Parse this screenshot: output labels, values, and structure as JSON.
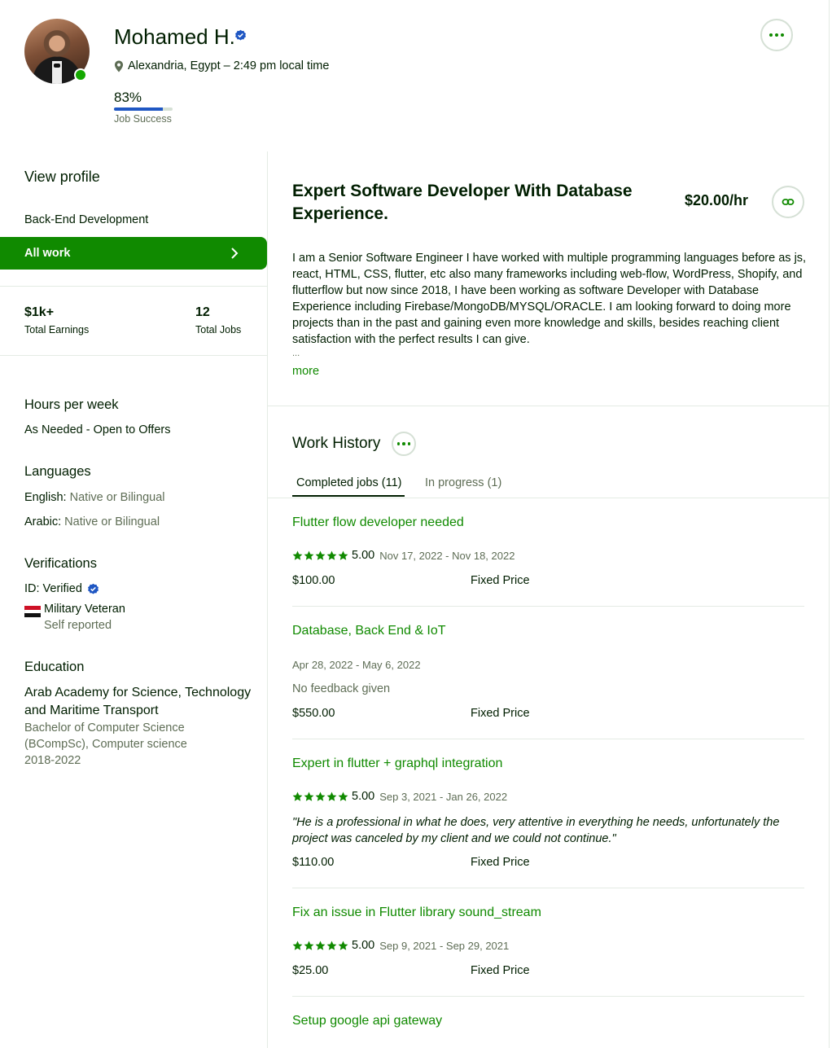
{
  "profile": {
    "name": "Mohamed H.",
    "location": "Alexandria, Egypt – 2:49 pm local time",
    "job_success_value": "83%",
    "job_success_percent": 83,
    "job_success_label": "Job Success"
  },
  "sidebar": {
    "view_profile": "View profile",
    "specialty": "Back-End Development",
    "all_work": "All work",
    "stats": [
      {
        "value": "$1k+",
        "label": "Total Earnings"
      },
      {
        "value": "12",
        "label": "Total Jobs"
      }
    ],
    "hours": {
      "title": "Hours per week",
      "value": "As Needed - Open to Offers"
    },
    "languages": {
      "title": "Languages",
      "items": [
        {
          "name": "English:",
          "level": "Native or Bilingual"
        },
        {
          "name": "Arabic:",
          "level": "Native or Bilingual"
        }
      ]
    },
    "verifications": {
      "title": "Verifications",
      "id_label": "ID:",
      "id_value": "Verified",
      "veteran": "Military Veteran",
      "veteran_note": "Self reported"
    },
    "education": {
      "title": "Education",
      "school": "Arab Academy for Science, Technology and Maritime Transport",
      "degree": "Bachelor of Computer Science (BCompSc), Computer science",
      "years": "2018-2022"
    }
  },
  "main": {
    "headline": "Expert Software Developer With Database Experience.",
    "rate": "$20.00/hr",
    "overview": "I am a Senior Software Engineer I have worked with multiple programming languages before as js, react, HTML, CSS, flutter, etc also many frameworks including web-flow, WordPress, Shopify, and flutterflow but now since 2018, I have been working as software Developer with Database Experience including Firebase/MongoDB/MYSQL/ORACLE. I am looking forward to doing more projects than in the past and gaining even more knowledge and skills, besides reaching client satisfaction with the perfect results I can give.",
    "ellipsis": "...",
    "more_link": "more",
    "work_history_title": "Work History",
    "tabs": [
      {
        "label": "Completed jobs (11)",
        "active": true
      },
      {
        "label": "In progress (1)",
        "active": false
      }
    ],
    "jobs": [
      {
        "title": "Flutter flow developer needed",
        "rating": "5.00",
        "dates": "Nov 17, 2022 - Nov 18, 2022",
        "price": "$100.00",
        "type": "Fixed Price"
      },
      {
        "title": "Database, Back End & IoT",
        "dates": "Apr 28, 2022 - May 6, 2022",
        "feedback": "No feedback given",
        "price": "$550.00",
        "type": "Fixed Price"
      },
      {
        "title": "Expert in flutter + graphql integration",
        "rating": "5.00",
        "dates": "Sep 3, 2021 - Jan 26, 2022",
        "quote": "\"He is a professional in what he does, very attentive in everything he needs, unfortunately the project was canceled by my client and we could not continue.\"",
        "price": "$110.00",
        "type": "Fixed Price"
      },
      {
        "title": "Fix an issue in Flutter library sound_stream",
        "rating": "5.00",
        "dates": "Sep 9, 2021 - Sep 29, 2021",
        "price": "$25.00",
        "type": "Fixed Price"
      },
      {
        "title": "Setup google api gateway"
      }
    ]
  },
  "colors": {
    "brand_green": "#108a00",
    "online_green": "#14a800",
    "verified_blue": "#1f57c3",
    "text": "#001e00",
    "muted": "#5e6d55"
  }
}
